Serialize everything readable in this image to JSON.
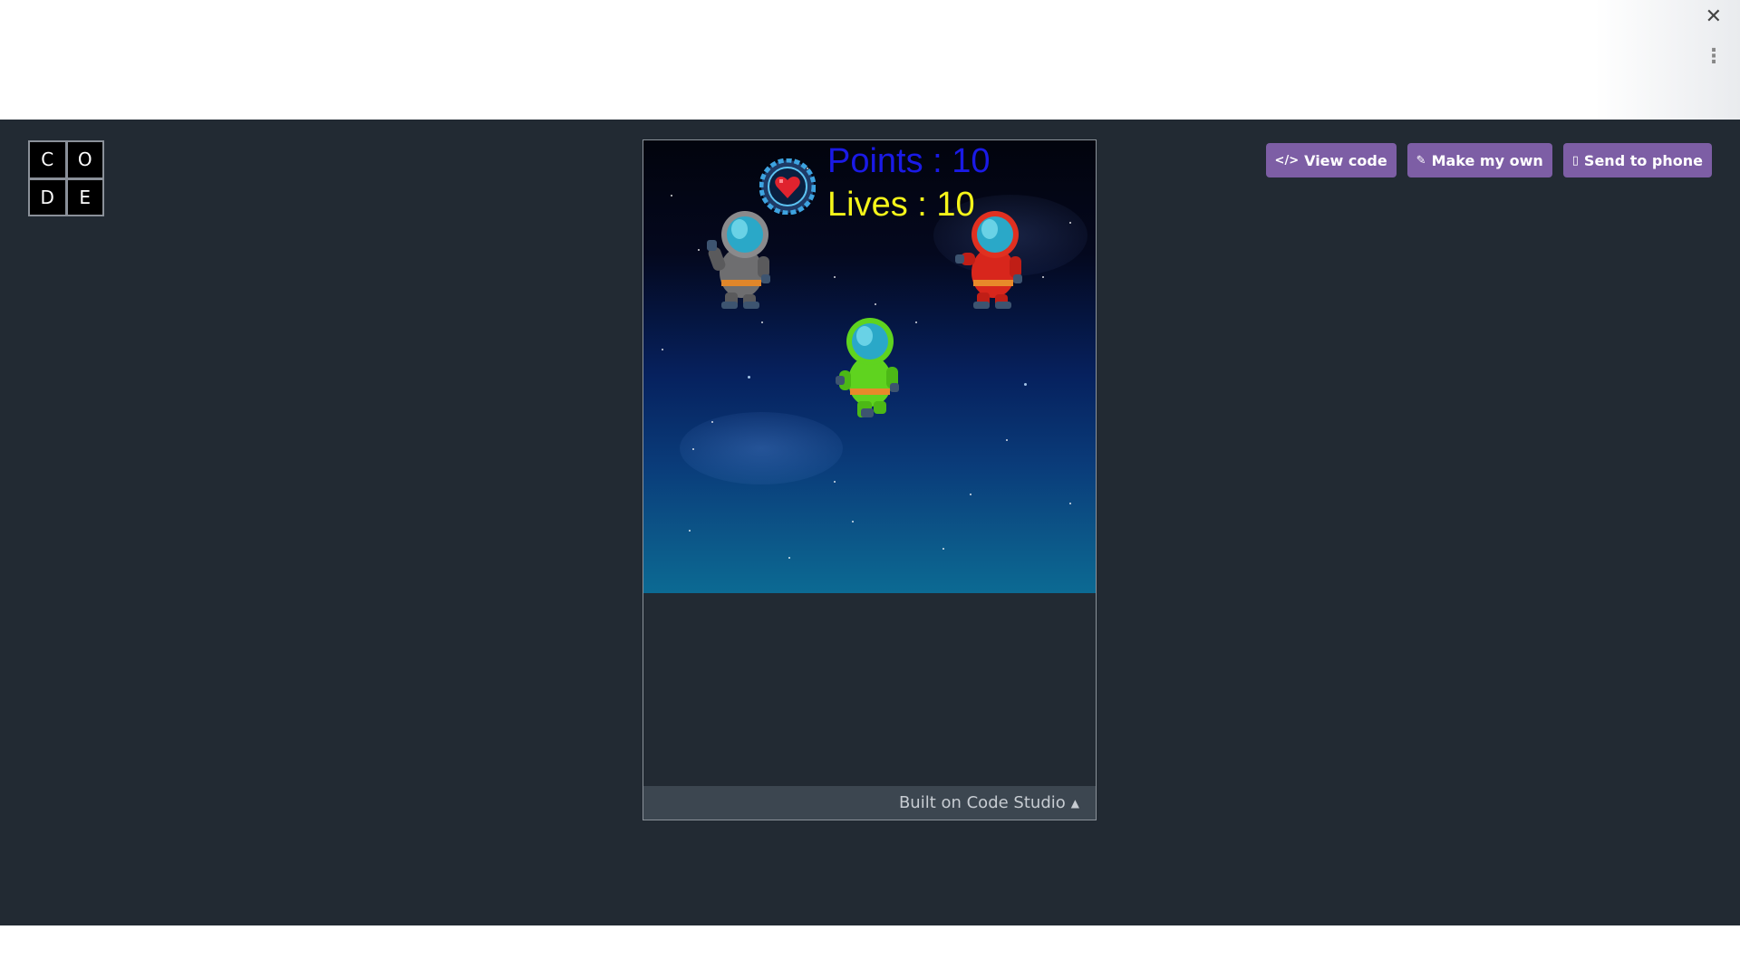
{
  "logo": {
    "letters": [
      "C",
      "O",
      "D",
      "E"
    ]
  },
  "header": {
    "close_glyph": "✕",
    "menu_glyph": "⋮"
  },
  "actions": {
    "view_code": {
      "icon": "</>",
      "label": "View code"
    },
    "make_my_own": {
      "icon": "✎",
      "label": "Make my own"
    },
    "send_to_phone": {
      "icon": "▯",
      "label": "Send to phone"
    }
  },
  "game": {
    "points_text": "Points : 10",
    "lives_text": "Lives : 10",
    "sprites": [
      "heart-icon",
      "gray-astronaut",
      "red-astronaut",
      "green-astronaut"
    ],
    "colors": {
      "points": "#1a1ae6",
      "lives": "#f5f51a"
    }
  },
  "footer": {
    "label": "Built on Code Studio",
    "caret": "▲"
  },
  "colors": {
    "accent": "#7d5ea5",
    "background": "#222a33"
  }
}
